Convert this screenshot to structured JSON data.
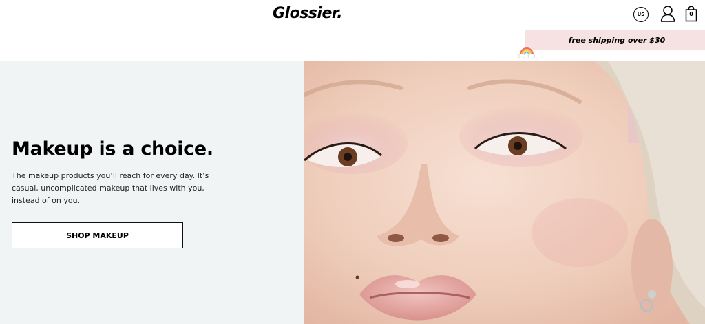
{
  "header": {
    "logo": "Glossier.",
    "region_label": "US",
    "bag_count": "0"
  },
  "promo": {
    "text": "free shipping over $30"
  },
  "hero": {
    "title": "Makeup is a choice.",
    "body": "The makeup products you’ll reach for every day. It’s casual, uncomplicated makeup that lives with you, instead of on you.",
    "cta_label": "SHOP MAKEUP"
  },
  "colors": {
    "hero_left_bg": "#f1f4f4",
    "promo_bg": "#f6e1e3",
    "skin": "#f0d2c2",
    "hair": "#e7ddd0"
  },
  "icons": [
    "rainbow-icon",
    "user-icon",
    "shopping-bag-icon"
  ]
}
